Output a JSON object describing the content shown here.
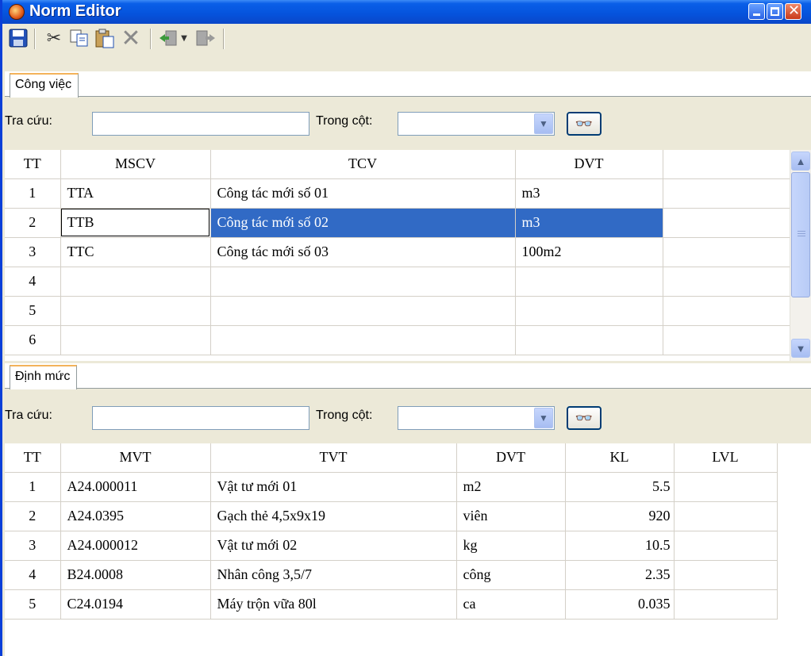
{
  "window": {
    "title": "Norm Editor"
  },
  "toolbar": {
    "icons": [
      "save-icon",
      "cut-icon",
      "copy-icon",
      "paste-icon",
      "delete-icon",
      "import-icon",
      "dropdown-arrow-icon",
      "export-icon"
    ]
  },
  "cong_viec": {
    "tab_label": "Công việc",
    "search_label": "Tra cứu:",
    "search_value": "",
    "column_label": "Trong cột:",
    "column_value": "",
    "columns": [
      "TT",
      "MSCV",
      "TCV",
      "DVT"
    ],
    "rows": [
      {
        "tt": "1",
        "mscv": "TTA",
        "tcv": "Công tác mới số 01",
        "dvt": "m3"
      },
      {
        "tt": "2",
        "mscv": "TTB",
        "tcv": "Công tác mới số 02",
        "dvt": "m3"
      },
      {
        "tt": "3",
        "mscv": "TTC",
        "tcv": "Công tác mới số 03",
        "dvt": "100m2"
      },
      {
        "tt": "4",
        "mscv": "",
        "tcv": "",
        "dvt": ""
      },
      {
        "tt": "5",
        "mscv": "",
        "tcv": "",
        "dvt": ""
      },
      {
        "tt": "6",
        "mscv": "",
        "tcv": "",
        "dvt": ""
      }
    ]
  },
  "dinh_muc": {
    "tab_label": "Định mức",
    "search_label": "Tra cứu:",
    "search_value": "",
    "column_label": "Trong cột:",
    "column_value": "",
    "columns": [
      "TT",
      "MVT",
      "TVT",
      "DVT",
      "KL",
      "LVL"
    ],
    "rows": [
      {
        "tt": "1",
        "mvt": "A24.000011",
        "tvt": "Vật tư mới 01",
        "dvt": "m2",
        "kl": "5.5",
        "lvl": ""
      },
      {
        "tt": "2",
        "mvt": "A24.0395",
        "tvt": "Gạch thẻ 4,5x9x19",
        "dvt": "viên",
        "kl": "920",
        "lvl": ""
      },
      {
        "tt": "3",
        "mvt": "A24.000012",
        "tvt": "Vật tư mới 02",
        "dvt": "kg",
        "kl": "10.5",
        "lvl": ""
      },
      {
        "tt": "4",
        "mvt": "B24.0008",
        "tvt": "Nhân công 3,5/7",
        "dvt": "công",
        "kl": "2.35",
        "lvl": ""
      },
      {
        "tt": "5",
        "mvt": "C24.0194",
        "tvt": "Máy trộn vữa 80l",
        "dvt": "ca",
        "kl": "0.035",
        "lvl": ""
      }
    ]
  },
  "colors": {
    "title_bar": "#0553dc",
    "selection": "#316ac5",
    "tab_highlight": "#f3b35a"
  }
}
